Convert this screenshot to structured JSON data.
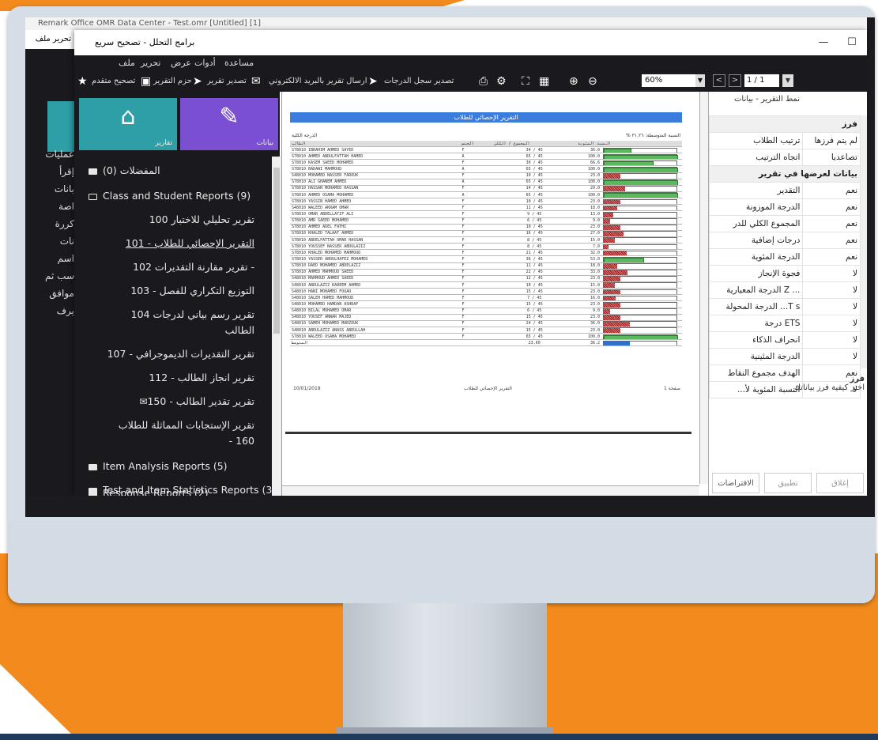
{
  "colors": {
    "orange": "#f28a1d",
    "navy": "#1f3a5a",
    "teal": "#2e9fa7",
    "purple": "#7b4fd1",
    "report_blue": "#3b7ddd"
  },
  "back_window": {
    "title": "Remark Office OMR Data Center - Test.omr [Untitled] [1]",
    "menu": "تحرير  ملف",
    "home_label": "النماذج",
    "side_labels": [
      "عمليات",
      "إقرأ",
      "بانات",
      "اصة",
      "كررة",
      "نات",
      "اسم",
      "سب ثم",
      "موافق",
      "يرف"
    ]
  },
  "window": {
    "title": "برامج التحلل - تصحيح سريع",
    "minimize": "—",
    "maximize": "☐"
  },
  "menubar": {
    "items": [
      "مساعدة",
      "أدوات",
      "عرض",
      "تحرير",
      "ملف"
    ]
  },
  "toolbar": {
    "advanced": "تصحيح متقدم",
    "report_pack": "حزم التقرير",
    "export_report": "تصدير تقرير",
    "email_report": "ارسال تقرير بالبريد الالكتروني",
    "export_grades": "تصدير سجل الدرجات",
    "zoom": "60%",
    "page": "1 / 1"
  },
  "tiles": {
    "home": "تقارير",
    "data": "بيانات"
  },
  "tree": {
    "favorites": "المفضلات (0)",
    "class_reports": "Class and Student Reports (9)",
    "reports": [
      "تقرير تحليلي للاختبار 100",
      "التقرير الإحصائي للطلاب - 101",
      "- تقرير مقارنة التقديرات 102",
      "التوزيع التكراري للفصل - 103",
      "تقرير رسم بياني لدرجات 104",
      "الطالب",
      "تقرير التقديرات الديموجرافي - 107",
      "تقرير انجاز الطالب - 112",
      "تقرير تقدير الطالب - 150",
      "تقرير الإستجابات المماثلة للطلاب",
      "160 -"
    ],
    "item_analysis": "Item Analysis Reports (5)",
    "test_item_stats": "Test and Item Statistics Reports (3)",
    "response_reports": "Response Reports (2)"
  },
  "report": {
    "banner": "التقرير الإحصائي للطلاب",
    "left_head": "الدرجة الكلية",
    "right_head": "% النسبة المتوسطة: ٣١.٢٦",
    "columns": [
      "الطالب",
      "الجنس",
      "المجموع / الكلي",
      "النسبة المئوية"
    ],
    "rows": [
      [
        "S78010 IBRAHIM AHMED SAYED",
        "F",
        "34 / 45",
        "36.0",
        0.36,
        "g"
      ],
      [
        "S78010 AHMED ABDULFATTAH HAMED",
        "A",
        "65 / 45",
        "100.0",
        1.0,
        "g"
      ],
      [
        "S78010 KASEM SAEED MOHAMED",
        "F",
        "30 / 45",
        "66.6",
        0.66,
        "g"
      ],
      [
        "S78010 BADAWI MAHMOUD",
        "A",
        "65 / 45",
        "100.0",
        1.0,
        "g"
      ],
      [
        "S48010 MOHAMED NASSER FAROUK",
        "F",
        "10 / 45",
        "23.0",
        0.23,
        "r"
      ],
      [
        "S78010 ALI GHANEM AHMED",
        "A",
        "65 / 45",
        "100.0",
        1.0,
        "g"
      ],
      [
        "S78010 HASSAN MOHAMED HASSAN",
        "F",
        "14 / 45",
        "29.0",
        0.29,
        "r"
      ],
      [
        "S78010 AHMED OSAMA MOHAMED",
        "A",
        "65 / 45",
        "100.0",
        1.0,
        "g"
      ],
      [
        "S78010 YASSIN HAMED AHMED",
        "F",
        "10 / 45",
        "23.0",
        0.23,
        "r"
      ],
      [
        "S48010 WALEED AKRAM OMAR",
        "F",
        "11 / 45",
        "18.0",
        0.18,
        "r"
      ],
      [
        "S78010 OMAR ABDELLATIF ALI",
        "F",
        "9 / 45",
        "13.0",
        0.13,
        "r"
      ],
      [
        "S78010 AMR SAEED MOHAMED",
        "F",
        "6 / 45",
        "9.0",
        0.09,
        "r"
      ],
      [
        "S78010 AHMED ADEL FATHI",
        "F",
        "10 / 45",
        "23.0",
        0.23,
        "r"
      ],
      [
        "S78010 KHALED TALAAT AHMED",
        "F",
        "16 / 45",
        "27.0",
        0.27,
        "r"
      ],
      [
        "S78010 ABDELFATTAH OMAR HASSAN",
        "F",
        "8 / 45",
        "15.0",
        0.15,
        "r"
      ],
      [
        "S78010 YOUSSEF NASSER ABDULAZIZ",
        "F",
        "8 / 45",
        "7.0",
        0.07,
        "r"
      ],
      [
        "S78010 KHALED MOHAMED MAHMOUD",
        "F",
        "21 / 45",
        "32.0",
        0.32,
        "r"
      ],
      [
        "S78010 YASSER ABDULHAFEZ MOHAMED",
        "F",
        "36 / 45",
        "53.0",
        0.53,
        "g"
      ],
      [
        "S78010 RAED MOHAMED ABDELAZIZ",
        "F",
        "11 / 45",
        "18.0",
        0.18,
        "r"
      ],
      [
        "S78010 AHMED MAHMOUD SAEED",
        "F",
        "22 / 45",
        "33.0",
        0.33,
        "r"
      ],
      [
        "S48010 MAHMOUD AHMED SAEED",
        "F",
        "12 / 45",
        "23.0",
        0.23,
        "r"
      ],
      [
        "S48010 ABDULAZIZ KAREEM AHMED",
        "F",
        "10 / 45",
        "15.0",
        0.15,
        "r"
      ],
      [
        "S48010 HANI MOHAMED FOUAD",
        "F",
        "15 / 45",
        "23.0",
        0.23,
        "r"
      ],
      [
        "S48010 SALEH HAMED MAHMOUD",
        "F",
        "7 / 45",
        "16.0",
        0.16,
        "r"
      ],
      [
        "S48010 MOHAMED HAMDAN ASHRAF",
        "F",
        "15 / 45",
        "23.0",
        0.23,
        "r"
      ],
      [
        "S48010 BILAL MOHAMED OMAR",
        "F",
        "6 / 45",
        "9.0",
        0.09,
        "r"
      ],
      [
        "S48010 YOUSEF ANWAR MAJED",
        "F",
        "15 / 45",
        "23.0",
        0.23,
        "r"
      ],
      [
        "S48010 SAMEH MOHAMED MARZOUK",
        "F",
        "24 / 45",
        "36.0",
        0.36,
        "r"
      ],
      [
        "S48010 ABDULAZIZ ANASS ABDULLAH",
        "F",
        "15 / 45",
        "23.0",
        0.23,
        "r"
      ],
      [
        "S78010 WALEED OSAMA MOHAMED",
        "F",
        "65 / 45",
        "100.0",
        1.0,
        "g"
      ]
    ],
    "total_label": "المتوسط",
    "total_score": "23.60",
    "total_pct": "36.2",
    "total_frac": 0.36,
    "footer_date": "10/01/2019",
    "footer_title": "التقرير الإحصائي للطلاب",
    "footer_page": "صفحة 1"
  },
  "props": {
    "header": "نمط التقرير - بيانات",
    "rows": [
      {
        "k": "فرز",
        "v": "",
        "cat": true
      },
      {
        "k": "ترتيب الطلاب",
        "v": "لم يتم فرزها"
      },
      {
        "k": "اتجاه الترتيب",
        "v": "تصاعديا"
      },
      {
        "k": "بيانات لعرضها في تقرير",
        "v": "",
        "cat": true
      },
      {
        "k": "التقدير",
        "v": "نعم"
      },
      {
        "k": "الدرجة الموزونة",
        "v": "نعم"
      },
      {
        "k": "المجموع الكلي للدر",
        "v": "نعم"
      },
      {
        "k": "درجات إضافية",
        "v": "نعم"
      },
      {
        "k": "الدرجة المئوية",
        "v": "نعم"
      },
      {
        "k": "فجوة الإنجاز",
        "v": "لا"
      },
      {
        "k": "... Z الدرجة المعيارية",
        "v": "لا"
      },
      {
        "k": "T s... الدرجة المحولة",
        "v": "لا"
      },
      {
        "k": "ETS درجة",
        "v": "لا"
      },
      {
        "k": "انحراف الذكاء",
        "v": "لا"
      },
      {
        "k": "الدرجة المئينية",
        "v": "لا"
      },
      {
        "k": "الهدف مجموع النقاط",
        "v": "نعم"
      },
      {
        "k": "النسبة المئوية لأ...",
        "v": "لا"
      }
    ],
    "desc_title": "فرز",
    "desc": "اختر كيفية فرز بياناتك",
    "defaults": "الافتراضات",
    "apply": "تطبيق",
    "close": "إغلاق"
  }
}
